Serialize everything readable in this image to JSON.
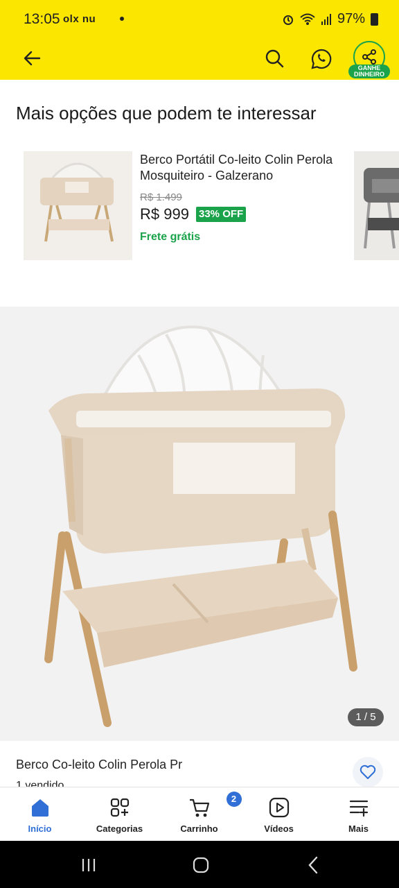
{
  "status_bar": {
    "time": "13:05",
    "apps": "olx nu",
    "battery": "97%"
  },
  "header": {
    "share_badge": "GANHE DINHEIRO",
    "icons": [
      "back-arrow-icon",
      "search-icon",
      "whatsapp-icon",
      "share-icon"
    ]
  },
  "section": {
    "title": "Mais opções que podem te interessar"
  },
  "suggestion": {
    "title": "Berco Portátil Co-leito Colin Perola Mosquiteiro - Galzerano",
    "old_price": "R$ 1.499",
    "price": "R$ 999",
    "discount": "33% OFF",
    "shipping": "Frete grátis"
  },
  "product": {
    "image_counter": "1 / 5",
    "name": "Berco Co-leito Colin Perola Pr",
    "sold": "1 vendido"
  },
  "bottom_nav": {
    "items": [
      {
        "label": "Início",
        "icon": "home-icon",
        "active": true
      },
      {
        "label": "Categorias",
        "icon": "categories-icon",
        "active": false
      },
      {
        "label": "Carrinho",
        "icon": "cart-icon",
        "active": false,
        "badge": "2"
      },
      {
        "label": "Vídeos",
        "icon": "video-icon",
        "active": false
      },
      {
        "label": "Mais",
        "icon": "more-icon",
        "active": false
      }
    ]
  },
  "colors": {
    "header": "#fbe600",
    "green": "#1aa34a",
    "blue": "#2f6fd6"
  }
}
